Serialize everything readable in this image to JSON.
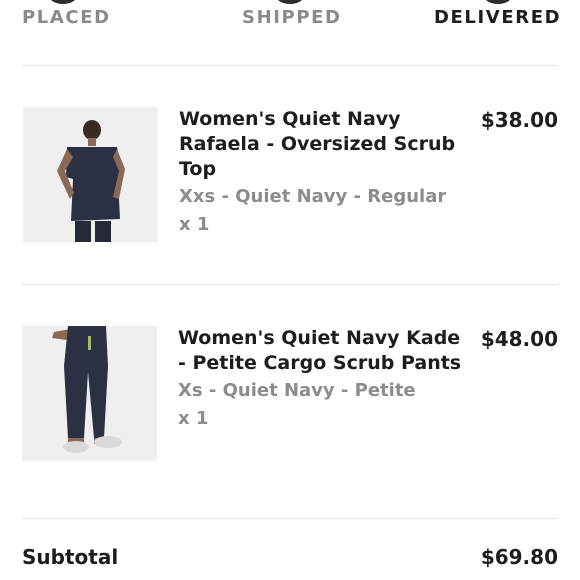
{
  "progress": {
    "steps": [
      {
        "label": "PLACED",
        "state": "complete"
      },
      {
        "label": "SHIPPED",
        "state": "complete"
      },
      {
        "label": "DELIVERED",
        "state": "current"
      }
    ]
  },
  "items": [
    {
      "name": "Women's Quiet Navy Rafaela - Oversized Scrub Top",
      "variant": "Xxs - Quiet Navy - Regular",
      "quantity": "x 1",
      "price": "$38.00",
      "image": "scrub-top-photo"
    },
    {
      "name": "Women's Quiet Navy Kade - Petite Cargo Scrub Pants",
      "variant": "Xs - Quiet Navy - Petite",
      "quantity": "x 1",
      "price": "$48.00",
      "image": "scrub-pants-photo"
    }
  ],
  "summary": {
    "subtotal_label": "Subtotal",
    "subtotal_value": "$69.80"
  },
  "colors": {
    "text": "#1d1d1f",
    "muted": "#8c8c8c",
    "navy": "#2b3142",
    "divider": "#e3e3e3"
  }
}
